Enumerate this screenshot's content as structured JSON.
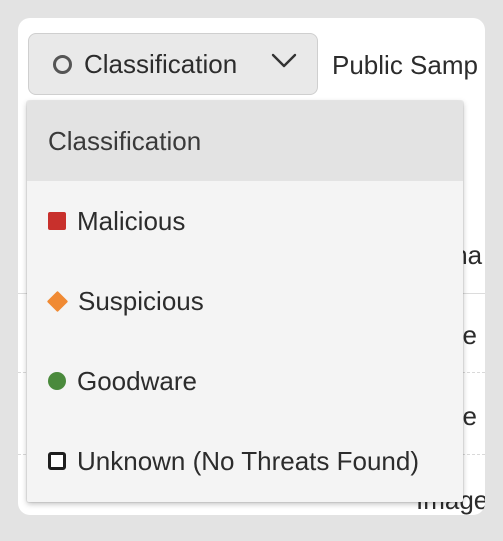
{
  "filter": {
    "label": "Classification",
    "icon": "ring-icon",
    "chevron": "chevron-down-icon"
  },
  "next_filter": {
    "label": "Public Samp"
  },
  "background": {
    "column_partial": "ma",
    "row_texts": [
      "ge",
      "ge",
      "Image"
    ]
  },
  "dropdown": {
    "header": "Classification",
    "items": [
      {
        "label": "Malicious",
        "icon": "square-icon",
        "color": "#c8302c"
      },
      {
        "label": "Suspicious",
        "icon": "diamond-icon",
        "color": "#f08a33"
      },
      {
        "label": "Goodware",
        "icon": "circle-icon",
        "color": "#4a8a3c"
      },
      {
        "label": "Unknown (No Threats Found)",
        "icon": "hollow-square-icon",
        "color": "#1f1f1f"
      }
    ]
  }
}
